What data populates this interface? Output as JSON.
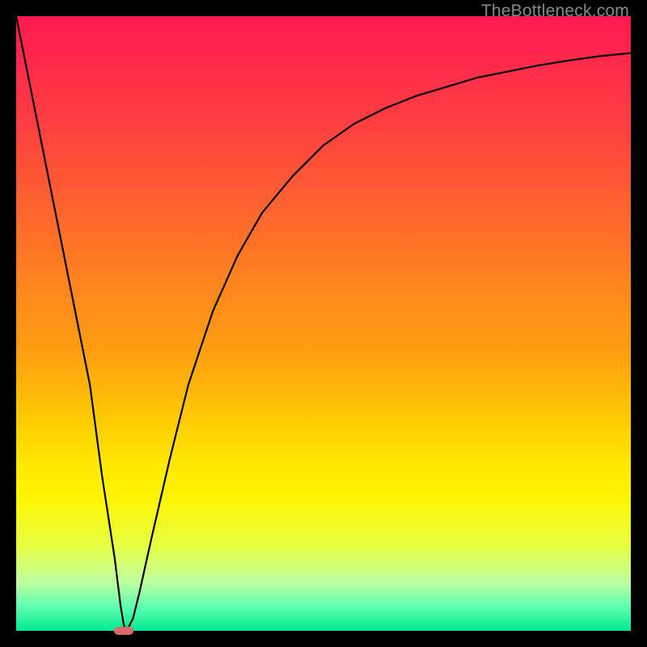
{
  "watermark": "TheBottleneck.com",
  "chart_data": {
    "type": "line",
    "title": "",
    "xlabel": "",
    "ylabel": "",
    "xlim": [
      0,
      100
    ],
    "ylim": [
      0,
      100
    ],
    "series": [
      {
        "name": "curve",
        "x": [
          0,
          4,
          8,
          12,
          14,
          16,
          17,
          17.5,
          18,
          19,
          20,
          22,
          25,
          28,
          32,
          36,
          40,
          45,
          50,
          55,
          60,
          65,
          70,
          75,
          80,
          85,
          90,
          95,
          100
        ],
        "y": [
          100,
          80,
          60,
          40,
          25,
          12,
          4,
          1,
          0,
          2,
          6,
          15,
          28,
          40,
          52,
          61,
          68,
          74,
          79,
          82.5,
          85,
          87,
          88.5,
          90,
          91,
          92,
          92.8,
          93.5,
          94
        ]
      }
    ],
    "marker": {
      "x": 17.5,
      "y": 0,
      "width_pct": 3.2,
      "height_pct": 1.2
    },
    "gradient_stops": [
      {
        "pct": 0,
        "color": "#ff1a4f"
      },
      {
        "pct": 18,
        "color": "#ff4040"
      },
      {
        "pct": 42,
        "color": "#ff8020"
      },
      {
        "pct": 67,
        "color": "#ffd000"
      },
      {
        "pct": 86,
        "color": "#e8ff40"
      },
      {
        "pct": 100,
        "color": "#00e890"
      }
    ]
  }
}
